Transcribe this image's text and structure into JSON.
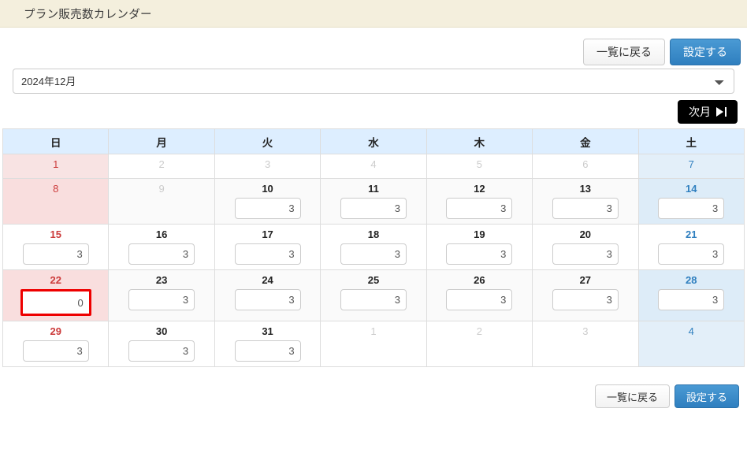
{
  "header": {
    "title": "プラン販売数カレンダー"
  },
  "toolbar": {
    "back_label": "一覧に戻る",
    "submit_label": "設定する"
  },
  "month_select": {
    "selected": "2024年12月",
    "options": [
      "2024年12月"
    ]
  },
  "nav": {
    "next_month_label": "次月",
    "next_month_icon": "skip-forward-icon"
  },
  "calendar": {
    "weekdays": [
      "日",
      "月",
      "火",
      "水",
      "木",
      "金",
      "土"
    ],
    "weeks": [
      [
        {
          "day": "1",
          "value": null,
          "disabled": true,
          "error": false
        },
        {
          "day": "2",
          "value": null,
          "disabled": true,
          "error": false
        },
        {
          "day": "3",
          "value": null,
          "disabled": true,
          "error": false
        },
        {
          "day": "4",
          "value": null,
          "disabled": true,
          "error": false
        },
        {
          "day": "5",
          "value": null,
          "disabled": true,
          "error": false
        },
        {
          "day": "6",
          "value": null,
          "disabled": true,
          "error": false
        },
        {
          "day": "7",
          "value": null,
          "disabled": true,
          "error": false
        }
      ],
      [
        {
          "day": "8",
          "value": null,
          "disabled": true,
          "error": false
        },
        {
          "day": "9",
          "value": null,
          "disabled": true,
          "error": false
        },
        {
          "day": "10",
          "value": "3",
          "disabled": false,
          "error": false
        },
        {
          "day": "11",
          "value": "3",
          "disabled": false,
          "error": false
        },
        {
          "day": "12",
          "value": "3",
          "disabled": false,
          "error": false
        },
        {
          "day": "13",
          "value": "3",
          "disabled": false,
          "error": false
        },
        {
          "day": "14",
          "value": "3",
          "disabled": false,
          "error": false
        }
      ],
      [
        {
          "day": "15",
          "value": "3",
          "disabled": false,
          "error": false
        },
        {
          "day": "16",
          "value": "3",
          "disabled": false,
          "error": false
        },
        {
          "day": "17",
          "value": "3",
          "disabled": false,
          "error": false
        },
        {
          "day": "18",
          "value": "3",
          "disabled": false,
          "error": false
        },
        {
          "day": "19",
          "value": "3",
          "disabled": false,
          "error": false
        },
        {
          "day": "20",
          "value": "3",
          "disabled": false,
          "error": false
        },
        {
          "day": "21",
          "value": "3",
          "disabled": false,
          "error": false
        }
      ],
      [
        {
          "day": "22",
          "value": "0",
          "disabled": false,
          "error": true
        },
        {
          "day": "23",
          "value": "3",
          "disabled": false,
          "error": false
        },
        {
          "day": "24",
          "value": "3",
          "disabled": false,
          "error": false
        },
        {
          "day": "25",
          "value": "3",
          "disabled": false,
          "error": false
        },
        {
          "day": "26",
          "value": "3",
          "disabled": false,
          "error": false
        },
        {
          "day": "27",
          "value": "3",
          "disabled": false,
          "error": false
        },
        {
          "day": "28",
          "value": "3",
          "disabled": false,
          "error": false
        }
      ],
      [
        {
          "day": "29",
          "value": "3",
          "disabled": false,
          "error": false
        },
        {
          "day": "30",
          "value": "3",
          "disabled": false,
          "error": false
        },
        {
          "day": "31",
          "value": "3",
          "disabled": false,
          "error": false
        },
        {
          "day": "1",
          "value": null,
          "disabled": true,
          "error": false
        },
        {
          "day": "2",
          "value": null,
          "disabled": true,
          "error": false
        },
        {
          "day": "3",
          "value": null,
          "disabled": true,
          "error": false
        },
        {
          "day": "4",
          "value": null,
          "disabled": true,
          "error": false
        }
      ]
    ]
  },
  "colors": {
    "header_bg": "#f4efdd",
    "sunday_header": "#d06a6a",
    "saturday_header": "#3d8fc4",
    "weekday_header": "#ddeeff",
    "primary_button": "#2f7fbf",
    "error_border": "#ee0000"
  }
}
